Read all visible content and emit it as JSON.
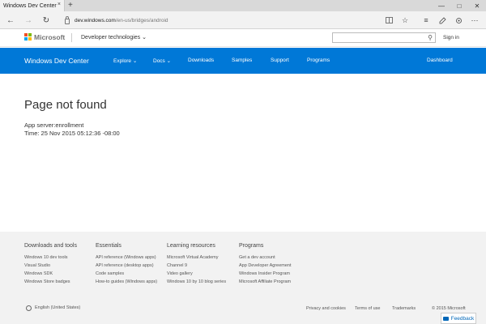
{
  "browser": {
    "tab_title": "Windows Dev Center",
    "tab_close": "×",
    "new_tab": "+",
    "url_host": "dev.windows.com",
    "url_path": "/en-us/bridges/android"
  },
  "ms_header": {
    "brand": "Microsoft",
    "dev_tech": "Developer technologies ⌄",
    "search_placeholder": "",
    "sign_in": "Sign in"
  },
  "nav": {
    "site_title": "Windows Dev Center",
    "items": [
      "Explore ⌄",
      "Docs ⌄",
      "Downloads",
      "Samples",
      "Support",
      "Programs"
    ],
    "dashboard": "Dashboard"
  },
  "main": {
    "title": "Page not found",
    "server": "App server:enrollment",
    "time": "Time: 25 Nov 2015 05:12:36 -08:00"
  },
  "footer": {
    "columns": [
      {
        "heading": "Downloads and tools",
        "links": [
          "Windows 10 dev tools",
          "Visual Studio",
          "Windows SDK",
          "Windows Store badges"
        ]
      },
      {
        "heading": "Essentials",
        "links": [
          "API reference (Windows apps)",
          "API reference (desktop apps)",
          "Code samples",
          "How-to guides (Windows apps)"
        ]
      },
      {
        "heading": "Learning resources",
        "links": [
          "Microsoft Virtual Academy",
          "Channel 9",
          "Video gallery",
          "Windows 10 by 10 blog series"
        ]
      },
      {
        "heading": "Programs",
        "links": [
          "Get a dev account",
          "App Developer Agreement",
          "Windows Insider Program",
          "Microsoft Affiliate Program"
        ]
      }
    ],
    "language": "English (United States)",
    "legal": [
      "Privacy and cookies",
      "Terms of use",
      "Trademarks",
      "© 2015 Microsoft"
    ],
    "feedback": "Feedback"
  },
  "colors": {
    "brand_blue": "#0078d7",
    "logo": [
      "#f25022",
      "#7fba00",
      "#00a4ef",
      "#ffb900"
    ]
  }
}
